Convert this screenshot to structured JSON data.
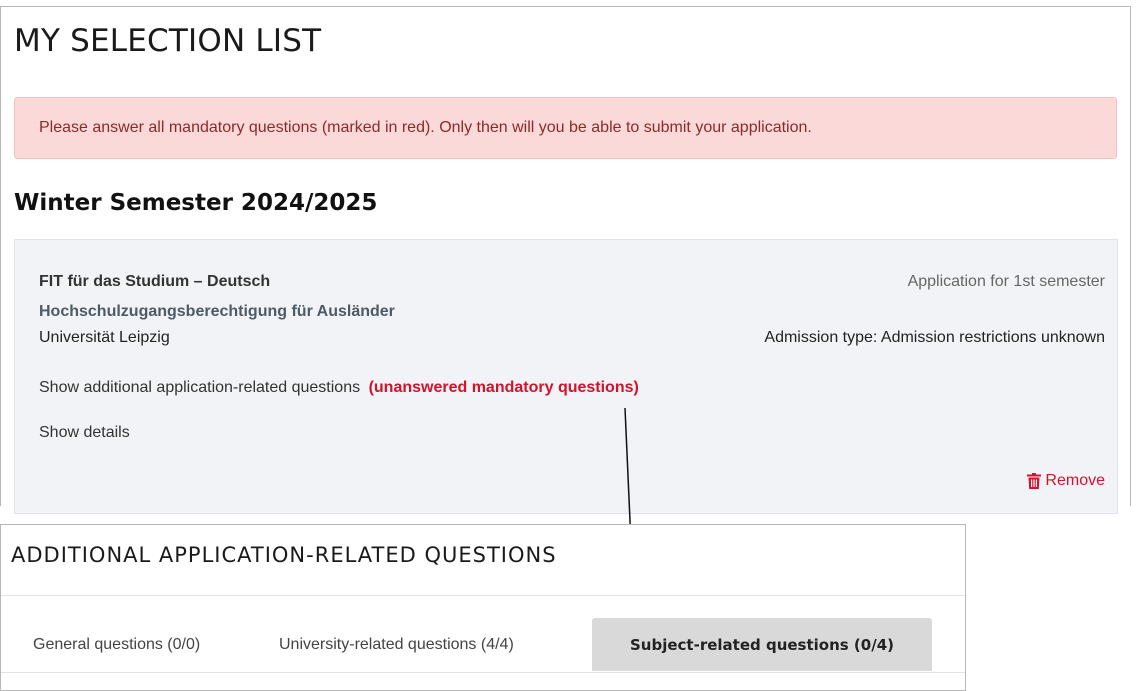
{
  "selection": {
    "title": "MY SELECTION LIST",
    "alert_text": "Please answer all mandatory questions (marked in red). Only then will you be able to submit your application.",
    "semester": "Winter Semester 2024/2025",
    "course": {
      "name": "FIT für das Studium – Deutsch",
      "subtitle": "Hochschulzugangsberechtigung für Ausländer",
      "university": "Universität Leipzig",
      "application_type": "Application for 1st semester",
      "admission_type": "Admission type: Admission restrictions unknown",
      "show_questions_label": "Show additional application-related questions",
      "mandatory_label": "(unanswered mandatory questions)",
      "show_details_label": "Show details",
      "remove_label": "Remove"
    }
  },
  "questions": {
    "title": "ADDITIONAL APPLICATION-RELATED QUESTIONS",
    "tabs": [
      {
        "label": "General questions (0/0)",
        "active": false
      },
      {
        "label": "University-related questions (4/4)",
        "active": false
      },
      {
        "label": "Subject-related questions (0/4)",
        "active": true
      }
    ]
  },
  "colors": {
    "alert_bg": "#fbd9d8",
    "mandatory_red": "#d0142c",
    "card_bg": "#f1f3f6",
    "active_tab_bg": "#d9d9d9"
  }
}
